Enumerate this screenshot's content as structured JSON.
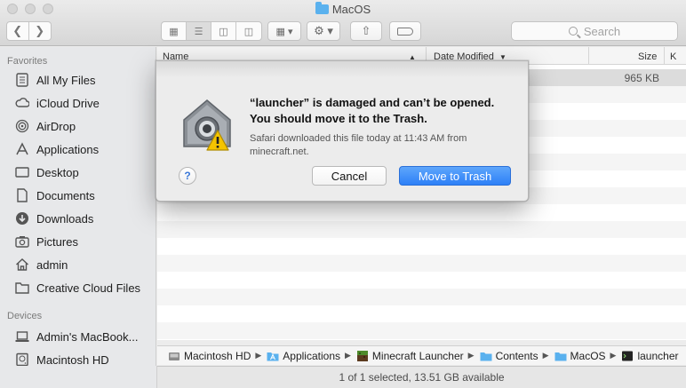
{
  "window": {
    "title": "MacOS",
    "traffic_lights": [
      "close",
      "minimize",
      "zoom"
    ]
  },
  "toolbar": {
    "back_icon": "chevron-left-icon",
    "forward_icon": "chevron-right-icon",
    "view_modes": [
      "icon-view-icon",
      "list-view-icon",
      "column-view-icon",
      "cover-flow-icon"
    ],
    "active_view": "list-view-icon",
    "arrange_icon": "arrange-grid-icon",
    "action_icon": "gear-icon",
    "share_icon": "share-icon",
    "tags_icon": "tag-icon",
    "search_placeholder": "Search"
  },
  "sidebar": {
    "favorites_heading": "Favorites",
    "favorites": [
      {
        "label": "All My Files",
        "icon": "all-files-icon"
      },
      {
        "label": "iCloud Drive",
        "icon": "cloud-icon"
      },
      {
        "label": "AirDrop",
        "icon": "airdrop-icon"
      },
      {
        "label": "Applications",
        "icon": "applications-icon"
      },
      {
        "label": "Desktop",
        "icon": "desktop-icon"
      },
      {
        "label": "Documents",
        "icon": "documents-icon"
      },
      {
        "label": "Downloads",
        "icon": "downloads-icon"
      },
      {
        "label": "Pictures",
        "icon": "camera-icon"
      },
      {
        "label": "admin",
        "icon": "home-icon"
      },
      {
        "label": "Creative Cloud Files",
        "icon": "folder-icon"
      }
    ],
    "devices_heading": "Devices",
    "devices": [
      {
        "label": "Admin's MacBook...",
        "icon": "laptop-icon"
      },
      {
        "label": "Macintosh HD",
        "icon": "hard-drive-icon"
      }
    ]
  },
  "file_list": {
    "columns": [
      "Name",
      "Date Modified",
      "Size",
      "K"
    ],
    "sort_column": "Name",
    "rows": [
      {
        "name": "",
        "date": "",
        "size": "965 KB",
        "selected": true
      }
    ]
  },
  "path_bar": [
    {
      "label": "Macintosh HD",
      "icon": "hard-drive-icon"
    },
    {
      "label": "Applications",
      "icon": "applications-folder-icon"
    },
    {
      "label": "Minecraft Launcher",
      "icon": "minecraft-icon"
    },
    {
      "label": "Contents",
      "icon": "folder-icon"
    },
    {
      "label": "MacOS",
      "icon": "folder-icon"
    },
    {
      "label": "launcher",
      "icon": "terminal-icon"
    }
  ],
  "status_bar": {
    "text": "1 of 1 selected, 13.51 GB available"
  },
  "dialog": {
    "icon": "gatekeeper-warning-icon",
    "title": "“launcher” is damaged and can’t be opened. You should move it to the Trash.",
    "message": "Safari downloaded this file today at 11:43 AM from minecraft.net.",
    "help_label": "?",
    "cancel_label": "Cancel",
    "primary_label": "Move to Trash",
    "colors": {
      "primary": "#2d80f7",
      "warning": "#f5c400"
    }
  }
}
